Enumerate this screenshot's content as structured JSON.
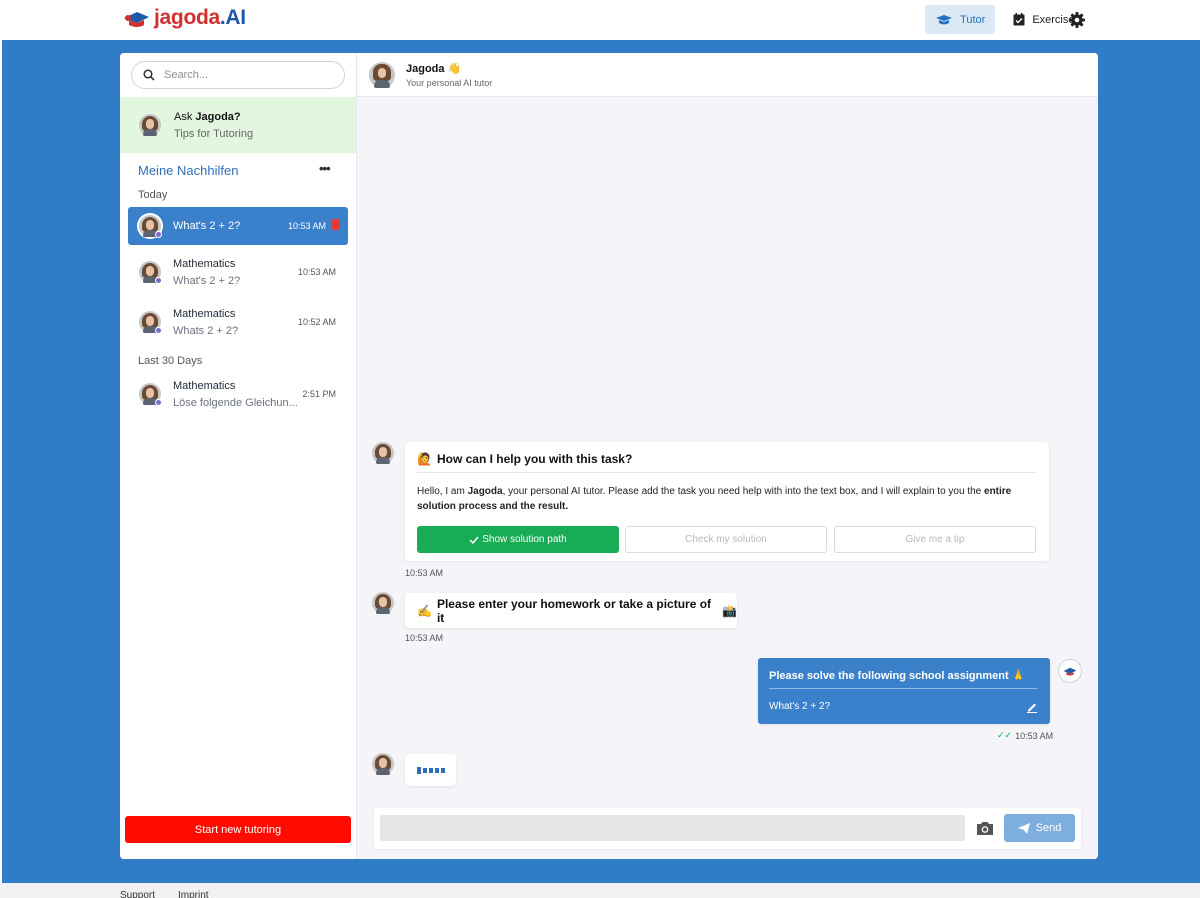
{
  "brand": {
    "name_prefix": "jagoda",
    "name_suffix": ".AI"
  },
  "nav": {
    "tutor_label": "Tutor",
    "exercises_label": "Exercises"
  },
  "sidebar": {
    "search_placeholder": "Search...",
    "ask": {
      "title_prefix": "Ask ",
      "title_bold": "Jagoda?",
      "subtitle": "Tips for Tutoring"
    },
    "section_title": "Meine Nachhilfen",
    "more": "•••",
    "groups": [
      {
        "label": "Today"
      },
      {
        "label": "Last 30 Days"
      }
    ],
    "conversations": [
      {
        "title": "What's 2 + 2?",
        "subtitle": "",
        "time": "10:53 AM",
        "active": true
      },
      {
        "title": "Mathematics",
        "subtitle": "What's 2 + 2?",
        "time": "10:53 AM",
        "active": false
      },
      {
        "title": "Mathematics",
        "subtitle": "Whats 2 + 2?",
        "time": "10:52 AM",
        "active": false
      },
      {
        "title": "Mathematics",
        "subtitle": "Löse folgende Gleichun...",
        "time": "2:51 PM",
        "active": false
      }
    ],
    "new_button": "Start new tutoring"
  },
  "chat": {
    "header": {
      "name": "Jagoda",
      "emoji": "👋",
      "subtitle": "Your personal AI tutor"
    },
    "messages": [
      {
        "head_emoji": "🙋",
        "title": "How can I help you with this task?",
        "body_1": "Hello, I am ",
        "body_bold_1": "Jagoda",
        "body_2": ", your personal AI tutor. Please add the task you need help with into the text box, and I will explain to you the ",
        "body_bold_2": "entire solution process and the result.",
        "options": [
          "Show solution path",
          "Check my solution",
          "Give me a tip"
        ],
        "time": "10:53 AM"
      },
      {
        "emoji_before": "✍️",
        "text": "Please enter your homework or take a picture of it",
        "emoji_after": "📸",
        "time": "10:53 AM"
      },
      {
        "title": "Please solve the following school assignment",
        "emoji": "🙏",
        "text": "What's 2 + 2?",
        "time": "10:53 AM",
        "check": "✓✓"
      }
    ],
    "composer": {
      "placeholder": "",
      "send_label": "Send"
    }
  },
  "footer": {
    "support": "Support",
    "imprint": "Imprint"
  },
  "colors": {
    "stage": "#317cc7",
    "accent": "#3a80cb",
    "success": "#18ad55",
    "danger": "#ff0b00",
    "highlight": "#e3f7e0"
  }
}
